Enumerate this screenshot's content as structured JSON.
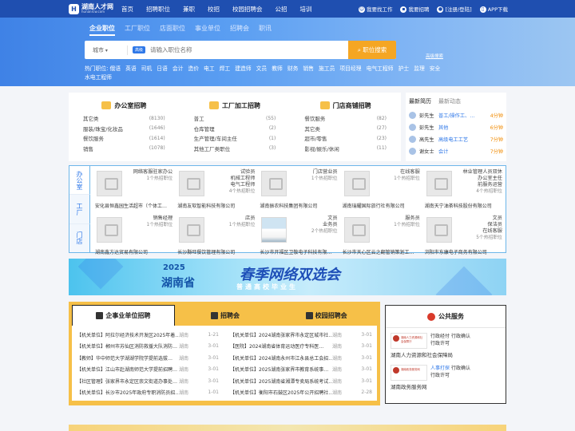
{
  "topbar": {
    "logo_name": "湖南人才网",
    "logo_url": "hunanrcw.com",
    "nav": [
      "首页",
      "招聘职位",
      "兼职",
      "校招",
      "校园招聘会",
      "公招",
      "培训"
    ],
    "right": {
      "find_job": "我要找工作",
      "hire": "我要招聘",
      "login": "[注册/登陆]",
      "app": "APP下载"
    }
  },
  "search": {
    "tabs": [
      "企业职位",
      "工厂职位",
      "店面职位",
      "事业单位",
      "招聘会",
      "职讯"
    ],
    "city": "城市",
    "tag": "高级",
    "placeholder": "请输入职位名称",
    "button": "职位搜索",
    "adv": "高级搜索",
    "hot_label": "热门职位:",
    "hot": [
      "俄语",
      "英语",
      "司机",
      "日语",
      "会计",
      "造价",
      "电工",
      "焊工",
      "建造师",
      "文员",
      "教师",
      "财务",
      "销售",
      "施工员",
      "项目经理",
      "电气工程师",
      "护士",
      "监理",
      "安全",
      "水电工程师"
    ]
  },
  "categories": [
    {
      "title": "办公室招聘",
      "rows": [
        {
          "n": "其它类",
          "c": "(8130)"
        },
        {
          "n": "服装/珠宝/化妆品",
          "c": "(1646)"
        },
        {
          "n": "餐饮服务",
          "c": "(1614)"
        },
        {
          "n": "销售",
          "c": "(1078)"
        }
      ]
    },
    {
      "title": "工厂加工招聘",
      "rows": [
        {
          "n": "普工",
          "c": "(55)"
        },
        {
          "n": "仓库管理",
          "c": "(2)"
        },
        {
          "n": "生产管理/车间主任",
          "c": "(1)"
        },
        {
          "n": "其他工厂类职位",
          "c": "(3)"
        }
      ]
    },
    {
      "title": "门店商铺招聘",
      "rows": [
        {
          "n": "餐饮服务",
          "c": "(82)"
        },
        {
          "n": "其它类",
          "c": "(27)"
        },
        {
          "n": "超市/零售",
          "c": "(23)"
        },
        {
          "n": "影视/娱乐/休闲",
          "c": "(11)"
        }
      ]
    }
  ],
  "feed": {
    "tabs": [
      "最新简历",
      "最新动态"
    ],
    "rows": [
      {
        "name": "彭先生",
        "job": "普工/操作工、…",
        "time": "4分钟"
      },
      {
        "name": "彭先生",
        "job": "其他",
        "time": "6分钟"
      },
      {
        "name": "高先生",
        "job": "高级电工工艺",
        "time": "7分钟"
      },
      {
        "name": "谢女士",
        "job": "会计",
        "time": "7分钟"
      }
    ]
  },
  "employers": {
    "tabs": [
      "办公室",
      "工厂",
      "门店"
    ],
    "cards": [
      {
        "jobs": [
          "网络客服驻家办公"
        ],
        "hot": "1个热招职位",
        "name": "安化县恒鑫园生活超市（个体工…",
        "photo": false
      },
      {
        "jobs": [
          "试验员",
          "机械工程师",
          "电气工程师"
        ],
        "hot": "4个热招职位",
        "name": "湖南友软智能科技有限公司",
        "photo": false
      },
      {
        "jobs": [
          "门店营业员"
        ],
        "hot": "1个热招职位",
        "name": "湖南振农科技集团有限公司",
        "photo": false
      },
      {
        "jobs": [
          "在线客服"
        ],
        "hot": "1个热招职位",
        "name": "湖南瑞耀国际旅行社有限公司",
        "photo": false
      },
      {
        "jobs": [
          "林业管理人员双休",
          "办公室主任",
          "前服务运营"
        ],
        "hot": "4个热招职位",
        "name": "湖南天宁油茶科技股份有限公司",
        "photo": false
      },
      {
        "jobs": [
          "销售经理"
        ],
        "hot": "1个热招职位",
        "name": "湖南鑫方达贸易有限公司",
        "photo": false
      },
      {
        "jobs": [
          "店员"
        ],
        "hot": "1个热招职位",
        "name": "长沙縣旺餐饮管理有限公司",
        "photo": false
      },
      {
        "jobs": [
          "文员",
          "业务员"
        ],
        "hot": "2个热招职位",
        "name": "长沙市开福区卫敬电子科技有限…",
        "photo": true
      },
      {
        "jobs": [
          "服务员"
        ],
        "hot": "1个热招职位",
        "name": "长沙市天心区云之翻管销策划工…",
        "photo": false
      },
      {
        "jobs": [
          "文员",
          "保洁员",
          "在线客服"
        ],
        "hot": "5个热招职位",
        "name": "浏阳市东康电子商务有限公司",
        "photo": false
      }
    ]
  },
  "banner": {
    "year": "2025",
    "prov": "湖南省",
    "title": "春季网络双选会",
    "sub": "普通高校毕业生"
  },
  "gov": {
    "tabs": [
      "企事业单位招聘",
      "招聘会",
      "校园招聘会"
    ],
    "rows": [
      {
        "t": "【机关单位】阿拉尔经济技术开发区2025年着…",
        "s": "湖南",
        "d": "1-21"
      },
      {
        "t": "【机关单位】2024湖南张家界市永定区城市社…",
        "s": "湖南",
        "d": "3-01"
      },
      {
        "t": "【机关单位】郴州市苏仙区消防救援大队消防…",
        "s": "湖南",
        "d": "3-01"
      },
      {
        "t": "【医院】2024湖南省体育运动医疗专科医…",
        "s": "湖南",
        "d": "3-01"
      },
      {
        "t": "【教师】华中师范大学湖湖学院学提前选拔…",
        "s": "湖南",
        "d": "3-01"
      },
      {
        "t": "【机关单位】2024湖南永州市江永县总工会招…",
        "s": "湖南",
        "d": "3-01"
      },
      {
        "t": "【机关单位】江山市赴湖南师范大学提前招聘…",
        "s": "湖南",
        "d": "3-01"
      },
      {
        "t": "【机关单位】2025湖南张家界市教育系统事…",
        "s": "湖南",
        "d": "3-01"
      },
      {
        "t": "【社区管理】张家界市永定区崇文街道办事处…",
        "s": "湖南",
        "d": "3-01"
      },
      {
        "t": "【机关单位】2025湖南省湘潭专卖局系统考试…",
        "s": "湖南",
        "d": "3-01"
      },
      {
        "t": "【机关单位】长沙市2025年政府专职消防员招…",
        "s": "湖南",
        "d": "1-01"
      },
      {
        "t": "【机关单位】衡阳市石鼓区2025年公开招聘社…",
        "s": "湖南",
        "d": "2-28"
      }
    ]
  },
  "public": {
    "title": "公共服务",
    "items": [
      {
        "logo": "湖南人力资源和社会保障厅",
        "links": [
          "行政经付",
          "行政确认",
          "行政许可"
        ],
        "name": "湖南人力资源和社会保障局"
      },
      {
        "logo": "湖南政务服务网",
        "links": [
          "人事打探",
          "行政确认",
          "行政许可"
        ],
        "name": "湖南政务服务网"
      }
    ]
  }
}
